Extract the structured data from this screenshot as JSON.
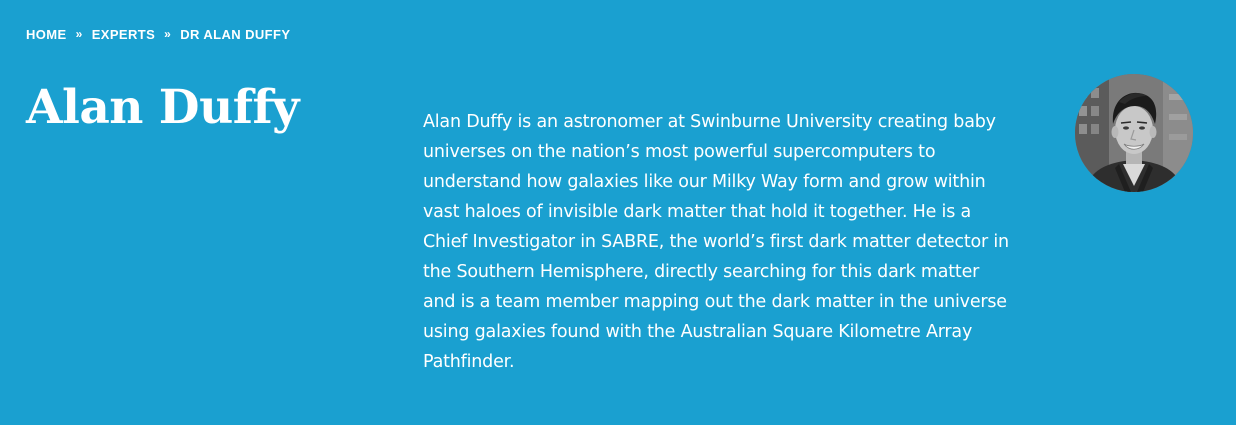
{
  "breadcrumb": {
    "items": [
      {
        "label": "HOME"
      },
      {
        "label": "EXPERTS"
      },
      {
        "label": "DR ALAN DUFFY"
      }
    ],
    "separator": "»"
  },
  "profile": {
    "name": "Alan Duffy",
    "bio": "Alan Duffy is an astronomer at Swinburne University creating baby universes on the nation’s most powerful supercomputers to understand how galaxies like our Milky Way form and grow within vast haloes of invisible dark matter that hold it together. He is a Chief Investigator in SABRE, the world’s first dark matter detector in the Southern Hemisphere, directly searching for this dark matter and is a team member mapping out the dark matter in the universe using galaxies found with the Australian Square Kilometre Array Pathfinder.",
    "avatar_icon": "person-photo"
  },
  "colors": {
    "background": "#1aa0d0",
    "text": "#ffffff"
  }
}
